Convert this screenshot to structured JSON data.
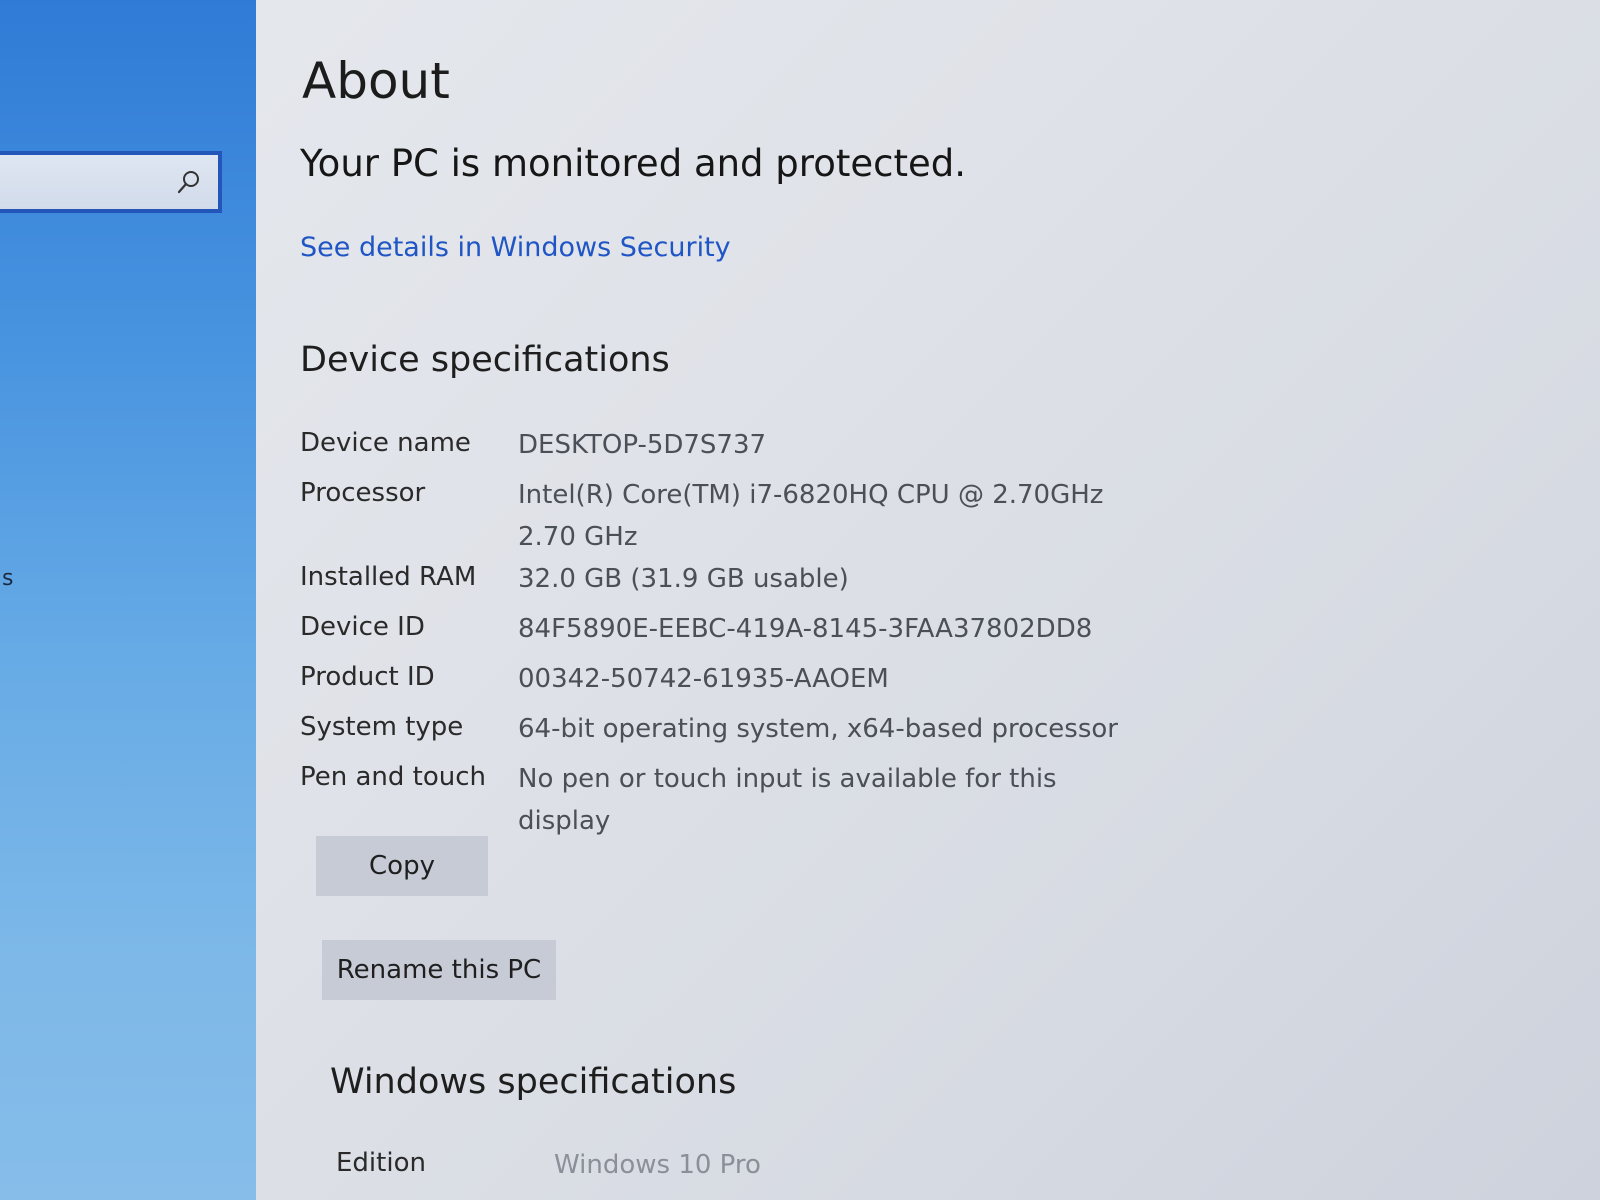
{
  "sidebar": {
    "search": {
      "placeholder": "",
      "value": ""
    },
    "partial_item": "s"
  },
  "header": {
    "title": "About",
    "status": "Your PC is monitored and protected.",
    "security_link": "See details in Windows Security"
  },
  "device_specs": {
    "heading": "Device specifications",
    "rows": [
      {
        "label": "Device name",
        "value": "DESKTOP-5D7S737"
      },
      {
        "label": "Processor",
        "value": "Intel(R) Core(TM) i7-6820HQ CPU @ 2.70GHz   2.70 GHz"
      },
      {
        "label": "Installed RAM",
        "value": "32.0 GB (31.9 GB usable)"
      },
      {
        "label": "Device ID",
        "value": "84F5890E-EEBC-419A-8145-3FAA37802DD8"
      },
      {
        "label": "Product ID",
        "value": "00342-50742-61935-AAOEM"
      },
      {
        "label": "System type",
        "value": "64-bit operating system, x64-based processor"
      },
      {
        "label": "Pen and touch",
        "value": "No pen or touch input is available for this display"
      }
    ],
    "copy_button": "Copy",
    "rename_button": "Rename this PC"
  },
  "windows_specs": {
    "heading": "Windows specifications",
    "rows": [
      {
        "label": "Edition",
        "value": "Windows 10 Pro"
      }
    ]
  },
  "colors": {
    "accent": "#1f55c4",
    "sidebar_top": "#2f7bd6",
    "sidebar_bottom": "#86bde9",
    "button_bg": "#c6cbd6"
  },
  "icons": {
    "search": "search-icon"
  }
}
